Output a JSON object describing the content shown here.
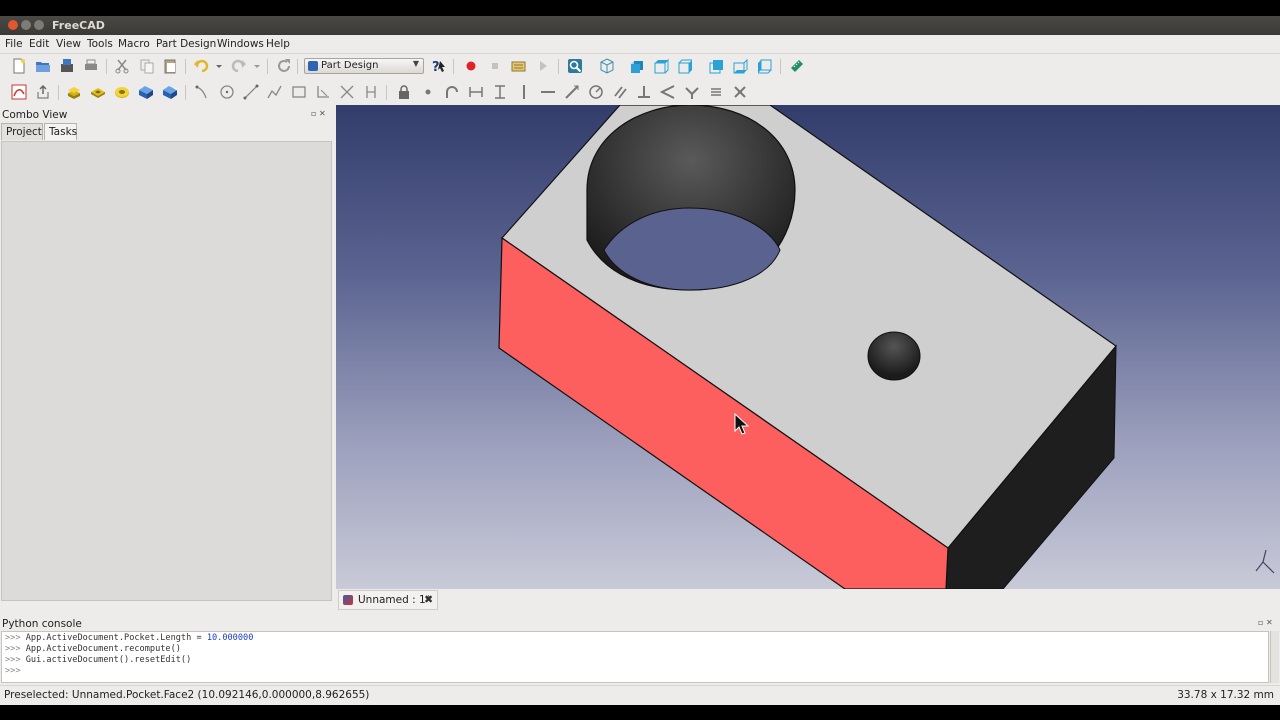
{
  "window": {
    "title": "FreeCAD"
  },
  "menu": [
    {
      "label": "File"
    },
    {
      "label": "Edit"
    },
    {
      "label": "View"
    },
    {
      "label": "Tools"
    },
    {
      "label": "Macro"
    },
    {
      "label": "Part Design"
    },
    {
      "label": "Windows"
    },
    {
      "label": "Help"
    }
  ],
  "toolbar": {
    "workbench": "Part Design"
  },
  "combo": {
    "title": "Combo View",
    "tabs": [
      {
        "label": "Project"
      },
      {
        "label": "Tasks"
      }
    ],
    "active_tab": "Tasks"
  },
  "document_tab": {
    "label": "Unnamed : 1*"
  },
  "python_console": {
    "title": "Python console",
    "lines": [
      {
        "prompt": ">>>",
        "code": "App.ActiveDocument.Pocket.Length = ",
        "value": "10.000000"
      },
      {
        "prompt": ">>>",
        "code": "App.ActiveDocument.recompute()",
        "value": ""
      },
      {
        "prompt": ">>>",
        "code": "Gui.activeDocument().resetEdit()",
        "value": ""
      },
      {
        "prompt": ">>>",
        "code": "",
        "value": ""
      }
    ]
  },
  "status": {
    "left": "Preselected: Unnamed.Pocket.Face2 (10.092146,0.000000,8.962655)",
    "right": "33.78 x 17.32 mm"
  },
  "colors": {
    "highlight_face": "#fd5e5e",
    "top_face": "#cfcfcf",
    "dark_face": "#1e1e1e",
    "viewport_top": "#333d6b",
    "viewport_bottom": "#c9cad8"
  }
}
